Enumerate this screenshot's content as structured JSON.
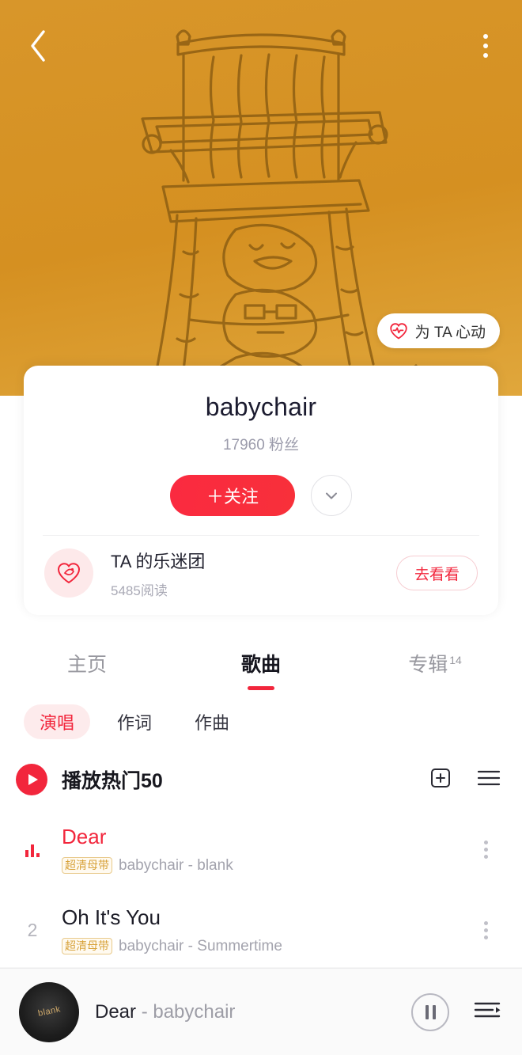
{
  "hero": {
    "back_icon": "chevron-left-icon",
    "menu_icon": "more-vertical-icon",
    "artwork_alt": "line-drawing-of-baby-high-chair",
    "heart_chip": {
      "label": "为 TA 心动",
      "icon": "heart-pulse-icon"
    }
  },
  "artist_card": {
    "name": "babychair",
    "followers": "17960 粉丝",
    "follow_label": "＋关注",
    "follow_color": "#fa2a40",
    "expand_icon": "chevron-down-icon",
    "fanclub": {
      "avatar_icon": "fanclub-heart-icon",
      "name": "TA 的乐迷团",
      "meta": "5485阅读",
      "cta_label": "去看看"
    }
  },
  "tabs": [
    {
      "label": "主页",
      "sup": "",
      "active": false
    },
    {
      "label": "歌曲",
      "sup": "",
      "active": true
    },
    {
      "label": "专辑",
      "sup": "14",
      "active": false
    }
  ],
  "subfilters": [
    {
      "label": "演唱",
      "active": true
    },
    {
      "label": "作词",
      "active": false
    },
    {
      "label": "作曲",
      "active": false
    }
  ],
  "playall": {
    "play_icon": "play-icon",
    "label": "播放热门50",
    "add_icon": "add-to-playlist-icon",
    "list_icon": "batch-manage-icon"
  },
  "songs": [
    {
      "index": "",
      "playing": true,
      "title": "Dear",
      "badge": "超清母带",
      "artist": "babychair - blank",
      "more_icon": "more-vertical-icon"
    },
    {
      "index": "2",
      "playing": false,
      "title": "Oh It's You",
      "badge": "超清母带",
      "artist": "babychair - Summertime",
      "more_icon": "more-vertical-icon"
    }
  ],
  "miniplayer": {
    "cover_text": "blank",
    "title": "Dear",
    "dash": " - ",
    "artist": "babychair",
    "pause_icon": "pause-icon",
    "playlist_icon": "playlist-icon"
  }
}
